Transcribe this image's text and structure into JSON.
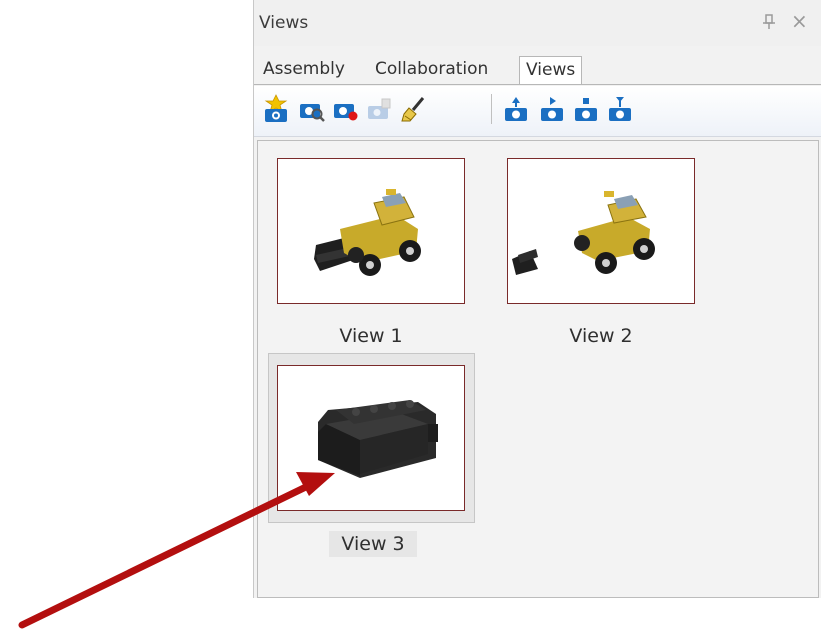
{
  "panel": {
    "title": "Views",
    "pin_glyph": "pin-icon",
    "close_glyph": "×"
  },
  "tabs": [
    {
      "label": "Assembly",
      "active": false
    },
    {
      "label": "Collaboration",
      "active": false
    },
    {
      "label": "Views",
      "active": true
    }
  ],
  "toolbar": {
    "icons": [
      "new-view-icon",
      "zoom-view-icon",
      "record-view-icon",
      "disabled-view-icon",
      "brush-icon",
      "view-nav-icon-1",
      "view-nav-icon-2",
      "view-nav-icon-3",
      "view-nav-icon-4"
    ]
  },
  "views": [
    {
      "label": "View 1",
      "image": "loader-truck-front",
      "selected": false
    },
    {
      "label": "View 2",
      "image": "loader-truck-detached-bucket",
      "selected": false
    },
    {
      "label": "View 3",
      "image": "bucket-part",
      "selected": true
    }
  ],
  "colors": {
    "thumb_border": "#7a2a2a",
    "arrow": "#b30f0f",
    "toolbar_blue": "#1b6fc2"
  }
}
